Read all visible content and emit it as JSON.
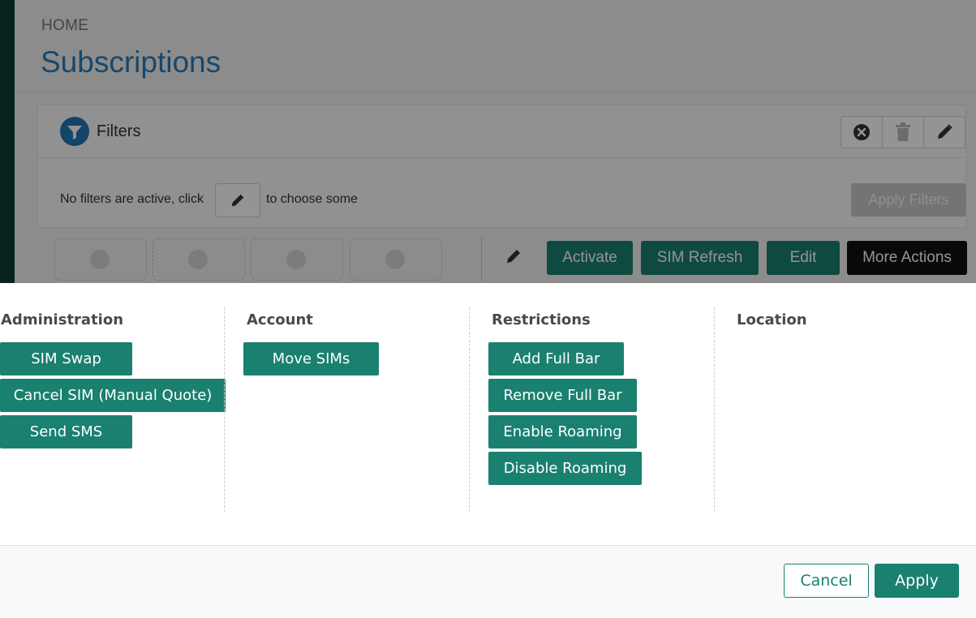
{
  "breadcrumb": "HOME",
  "page_title": "Subscriptions",
  "filters": {
    "title": "Filters",
    "status_text_before": "No filters are active, click",
    "status_text_after": "to choose some",
    "apply_label": "Apply Filters",
    "tool_icons": [
      "clear-icon",
      "trash-icon",
      "pencil-icon"
    ]
  },
  "action_bar": {
    "buttons": [
      "Activate",
      "SIM Refresh",
      "Edit",
      "More Actions"
    ]
  },
  "modal": {
    "columns": [
      {
        "title": "Administration",
        "items": [
          "SIM Swap",
          "Cancel SIM (Manual Quote)",
          "Send SMS"
        ]
      },
      {
        "title": "Account",
        "items": [
          "Move SIMs"
        ]
      },
      {
        "title": "Restrictions",
        "items": [
          "Add Full Bar",
          "Remove Full Bar",
          "Enable Roaming",
          "Disable Roaming"
        ]
      },
      {
        "title": "Location",
        "items": []
      }
    ],
    "footer": {
      "cancel_label": "Cancel",
      "apply_label": "Apply"
    }
  },
  "colors": {
    "accent": "#1a8070",
    "title_blue": "#2a7ab8",
    "more_actions": "#111111"
  }
}
